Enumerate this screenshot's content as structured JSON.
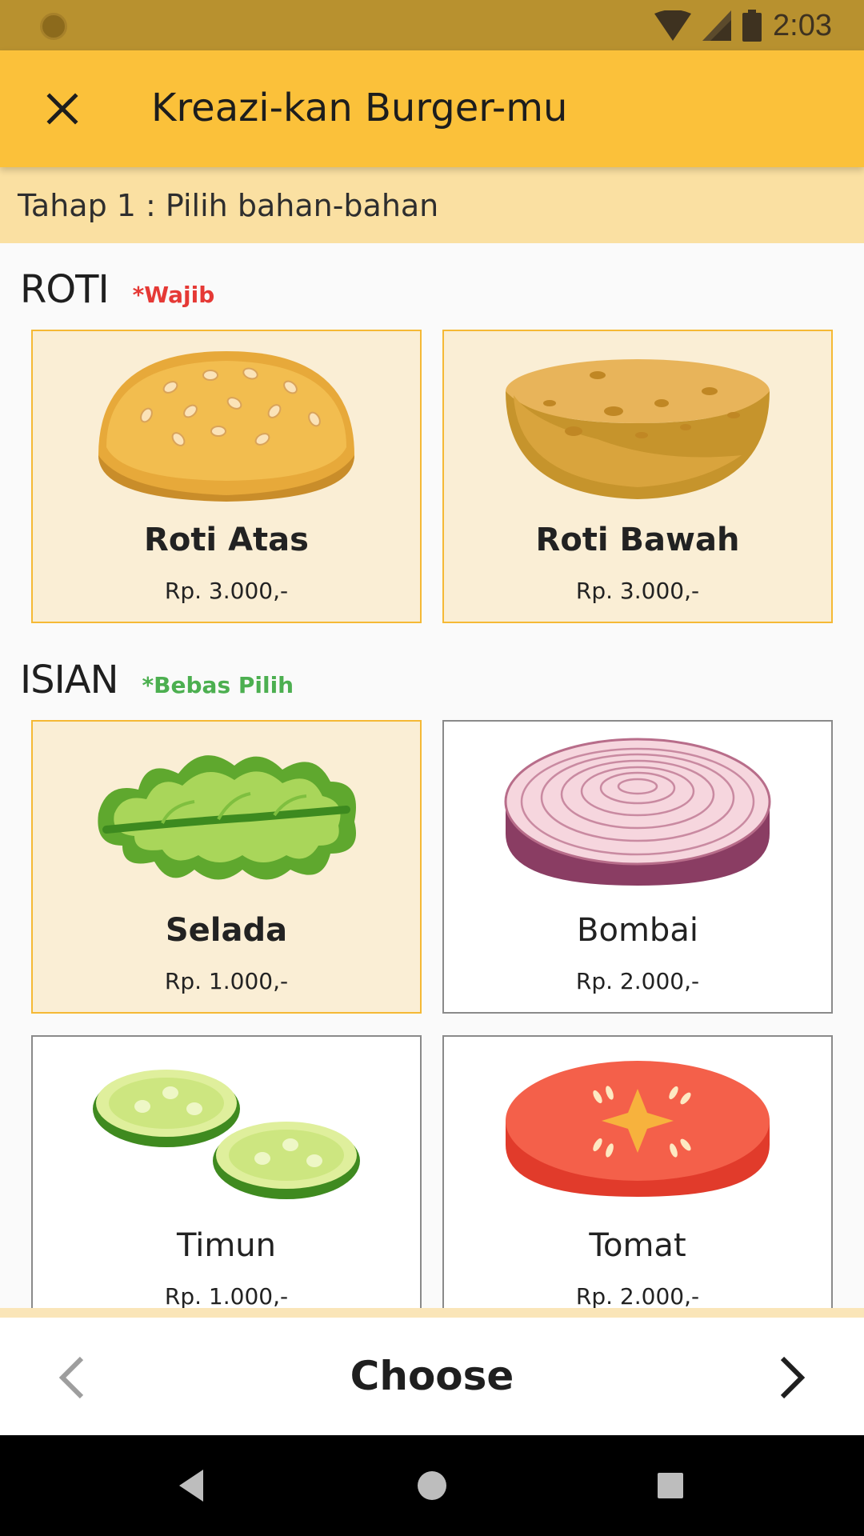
{
  "status_bar": {
    "time": "2:03"
  },
  "toolbar": {
    "title": "Kreazi-kan Burger-mu"
  },
  "step": {
    "text": "Tahap 1 : Pilih bahan-bahan"
  },
  "sections": {
    "roti": {
      "title": "ROTI",
      "note": "*Wajib",
      "note_color": "#e53935"
    },
    "isian": {
      "title": "ISIAN",
      "note": "*Bebas Pilih",
      "note_color": "#4caf50"
    }
  },
  "items": {
    "roti_atas": {
      "name": "Roti Atas",
      "price": "Rp. 3.000,-",
      "selected": true,
      "icon": "top-bun-icon"
    },
    "roti_bawah": {
      "name": "Roti Bawah",
      "price": "Rp. 3.000,-",
      "selected": true,
      "icon": "bottom-bun-icon"
    },
    "selada": {
      "name": "Selada",
      "price": "Rp. 1.000,-",
      "selected": true,
      "icon": "lettuce-icon"
    },
    "bombai": {
      "name": "Bombai",
      "price": "Rp. 2.000,-",
      "selected": false,
      "icon": "onion-icon"
    },
    "timun": {
      "name": "Timun",
      "price": "Rp. 1.000,-",
      "selected": false,
      "icon": "cucumber-icon"
    },
    "tomat": {
      "name": "Tomat",
      "price": "Rp. 2.000,-",
      "selected": false,
      "icon": "tomato-icon"
    }
  },
  "action_bar": {
    "label": "Choose"
  },
  "colors": {
    "toolbar": "#fbc13a",
    "status_bar": "#b8912f",
    "step_bar": "#fae0a2",
    "selected_card": "#faeed5",
    "selected_border": "#f5b935"
  }
}
